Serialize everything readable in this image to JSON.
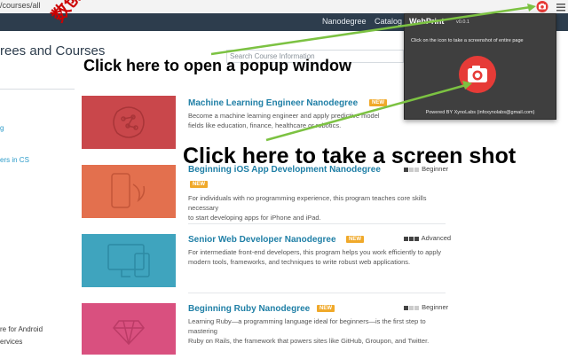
{
  "browser": {
    "url": "/courses/all",
    "camera_icon": "camera-icon",
    "menu_icon": "hamburger-menu-icon"
  },
  "nav": {
    "items": [
      "Nanodegree",
      "Catalog"
    ]
  },
  "page": {
    "title": "rees and Courses",
    "search_placeholder": "Search Course Information"
  },
  "sidebar": {
    "items": [
      "g",
      "ers in CS",
      "re for Android",
      "ervices"
    ]
  },
  "courses": [
    {
      "title": "Machine Learning Engineer Nanodegree",
      "badge": "NEW",
      "desc_lines": [
        "Become a machine learning engineer and apply predictive model",
        "fields like education, finance, healthcare or robotics."
      ],
      "level": "",
      "thumb_color": "#c9474b"
    },
    {
      "title": "Beginning iOS App Development Nanodegree",
      "badge": "NEW",
      "desc_lines": [
        "For individuals with no programming experience, this program teaches core skills necessary",
        "to start developing apps for iPhone and iPad."
      ],
      "level": "Beginner",
      "thumb_color": "#e3704e"
    },
    {
      "title": "Senior Web Developer Nanodegree",
      "badge": "NEW",
      "desc_lines": [
        "For intermediate front-end developers, this program helps you work efficiently to apply",
        "modern tools, frameworks, and techniques to write robust web applications."
      ],
      "level": "Advanced",
      "thumb_color": "#3fa4be"
    },
    {
      "title": "Beginning Ruby Nanodegree",
      "badge": "NEW",
      "desc_lines": [
        "Learning Ruby—a programming language ideal for beginners—is the first step to mastering",
        "Ruby on Rails, the framework that powers sites like GitHub, Groupon, and Twitter."
      ],
      "level": "Beginner",
      "thumb_color": "#d9507f"
    }
  ],
  "popup": {
    "title": "WebPrint",
    "version": "v0.0.1",
    "instruction": "Click on the icon to take a screenshot of entire page",
    "footer": "Powered BY XynoLabs (infoxynolabs@gmail.com)",
    "accent": "#e63b37"
  },
  "annotations": {
    "popup_hint": "Click here to open a popup window",
    "screenshot_hint": "Click here to take a screen shot",
    "watermark": "数创社ics66",
    "arrow_color": "#7cc242"
  }
}
